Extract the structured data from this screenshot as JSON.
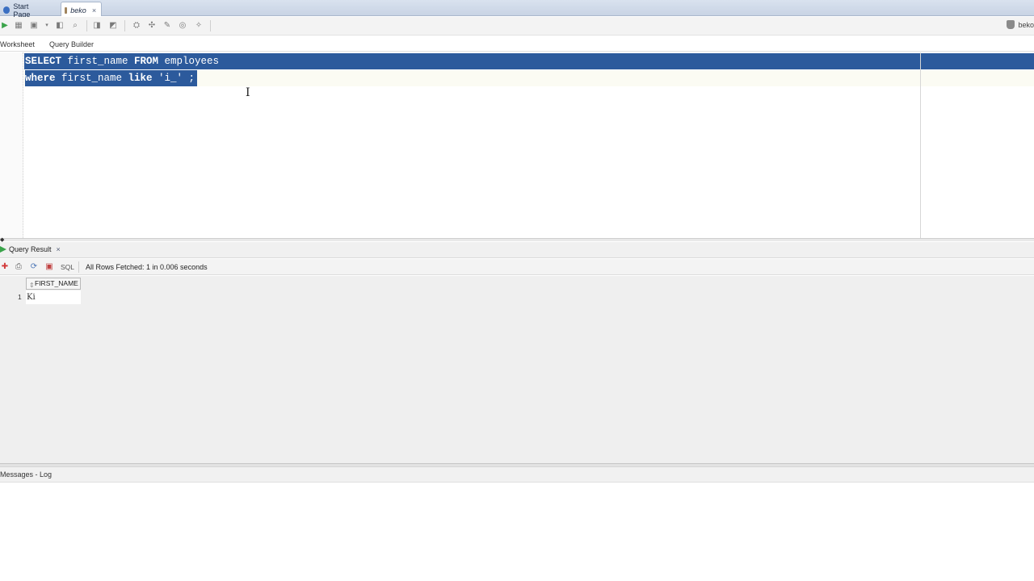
{
  "tabs": [
    {
      "label": "Start Page"
    },
    {
      "label": "beko"
    }
  ],
  "toolbar": {
    "icons": [
      "run-icon",
      "stop-icon",
      "commit-icon",
      "rollback-icon",
      "explain-icon",
      "autotrace-icon",
      "cancel-icon",
      "clear-icon",
      "sql-history-icon",
      "unshared-icon",
      "format-icon",
      "tuning-icon",
      "find-icon"
    ],
    "connection_label": "beko"
  },
  "subtabs": {
    "worksheet": "Worksheet",
    "query_builder": "Query Builder"
  },
  "editor": {
    "lines": [
      [
        "SELECT",
        " first_name ",
        "FROM",
        " employees"
      ],
      [
        "where",
        " first_name ",
        "like",
        " 'i_' ;"
      ]
    ]
  },
  "result": {
    "tab_label": "Query Result",
    "sql_label": "SQL",
    "status": "All Rows Fetched: 1 in 0.006 seconds",
    "columns": [
      "FIRST_NAME"
    ],
    "rows": [
      {
        "num": "1",
        "first_name": "Ki"
      }
    ]
  },
  "messages": {
    "tab_label": "Messages - Log"
  },
  "colors": {
    "selection": "#2c5a9c",
    "tabbar": "#c8d3e4"
  }
}
